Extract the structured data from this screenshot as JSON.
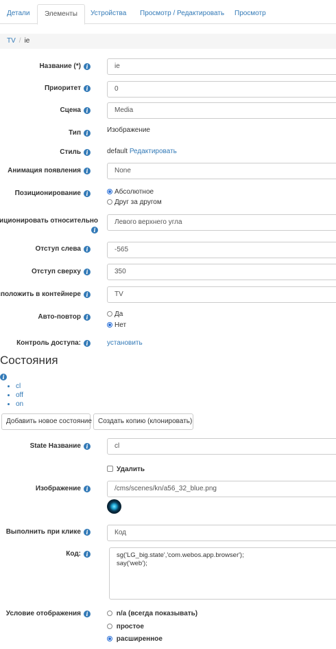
{
  "tabs": [
    "Детали",
    "Элементы",
    "Устройства",
    "Просмотр / Редактировать",
    "Просмотр"
  ],
  "breadcrumb": {
    "root": "TV",
    "current": "ie"
  },
  "form": {
    "name_label": "Название (*)",
    "name_value": "ie",
    "priority_label": "Приоритет",
    "priority_value": "0",
    "scene_label": "Сцена",
    "scene_value": "Media",
    "type_label": "Тип",
    "type_value": "Изображение",
    "style_label": "Стиль",
    "style_value": "default",
    "style_edit": "Редактировать",
    "anim_label": "Анимация появления",
    "anim_value": "None",
    "positioning_label": "Позиционирование",
    "positioning_opt1": "Абсолютное",
    "positioning_opt2": "Друг за другом",
    "relative_label": "озиционировать относительно",
    "relative_value": "Левого верхнего угла",
    "offset_left_label": "Отступ слева",
    "offset_left_value": "-565",
    "offset_top_label": "Отступ сверху",
    "offset_top_value": "350",
    "container_label": "Расположить в контейнере",
    "container_value": "TV",
    "autorepeat_label": "Авто-повтор",
    "autorepeat_yes": "Да",
    "autorepeat_no": "Нет",
    "access_label": "Контроль доступа:",
    "access_link": "установить"
  },
  "states": {
    "title": "Состояния",
    "items": [
      "cl",
      "off",
      "on"
    ],
    "add_button": "Добавить новое состояние",
    "clone_button": "Создать копию (клонировать)"
  },
  "state_form": {
    "name_label": "State Название",
    "name_value": "cl",
    "delete_label": "Удалить",
    "image_label": "Изображение",
    "image_value": "/cms/scenes/kn/a56_32_blue.png",
    "onclick_label": "Выполнить при клике",
    "onclick_value": "Код",
    "code_label": "Код:",
    "code_line1": "sg('LG_big.state','com.webos.app.browser');",
    "code_line2": "say('web');",
    "condition_label": "Условие отображения",
    "cond_opt1": "n/a (всегда показывать)",
    "cond_opt2": "простое",
    "cond_opt3": "расширенное"
  }
}
